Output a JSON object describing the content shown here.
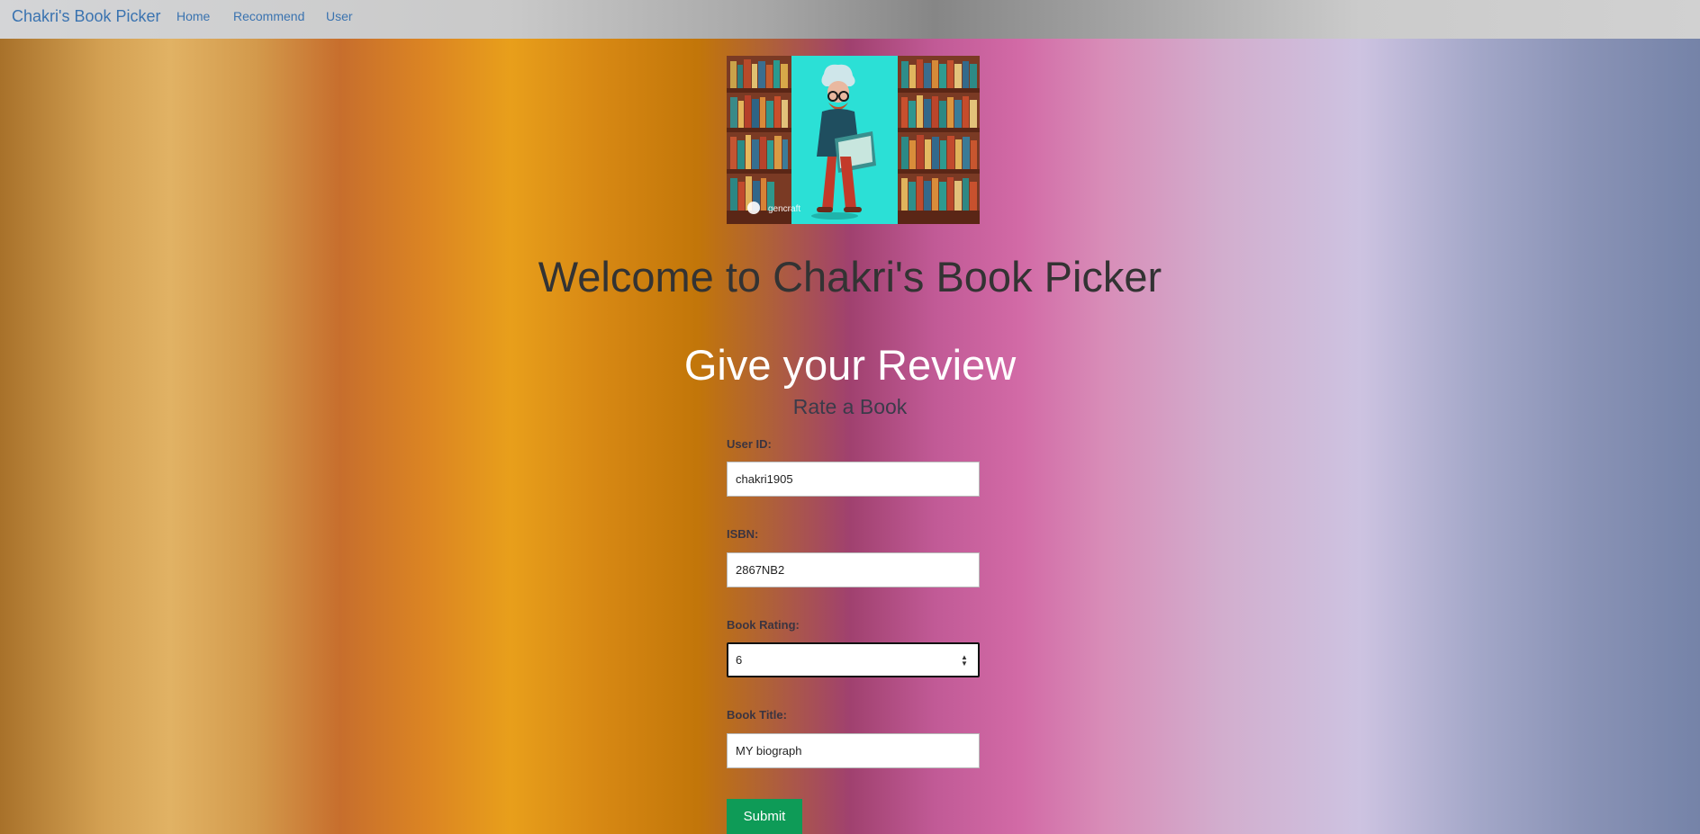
{
  "navbar": {
    "brand": "Chakri's Book Picker",
    "links": [
      "Home",
      "Recommend",
      "User"
    ]
  },
  "hero": {
    "watermark": "gencraft"
  },
  "welcome_heading": "Welcome to Chakri's Book Picker",
  "form": {
    "title": "Give your Review",
    "subtitle": "Rate a Book",
    "fields": [
      {
        "label": "User ID:",
        "value": "chakri1905"
      },
      {
        "label": "ISBN:",
        "value": "2867NB2"
      },
      {
        "label": "Book Rating:",
        "value": "6"
      },
      {
        "label": "Book Title:",
        "value": "MY biograph"
      }
    ],
    "submit_label": "Submit"
  },
  "colors": {
    "brand_link": "#3a73b0",
    "submit": "#0e9b57"
  }
}
